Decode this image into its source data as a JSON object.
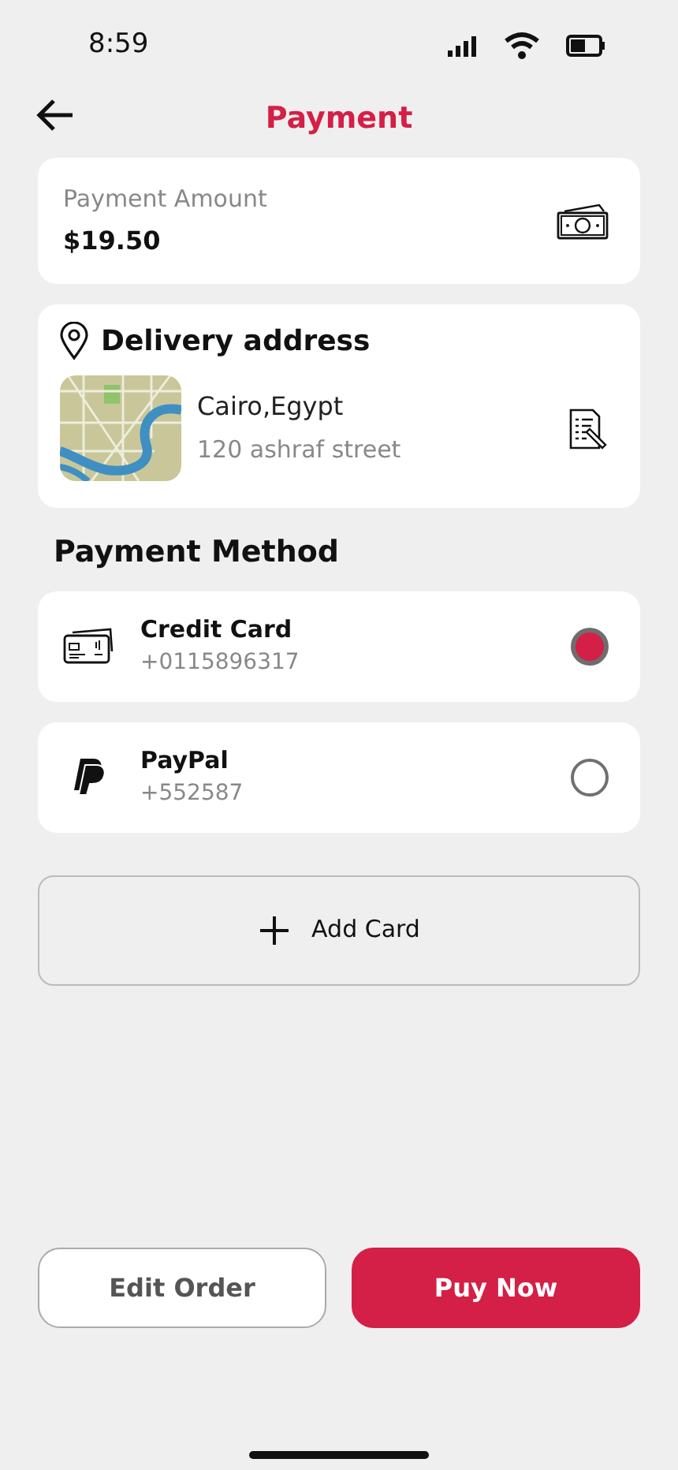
{
  "status_bar": {
    "time": "8:59"
  },
  "header": {
    "title": "Payment"
  },
  "amount": {
    "label": "Payment Amount",
    "value": "$19.50"
  },
  "delivery": {
    "title": "Delivery address",
    "city": "Cairo,Egypt",
    "street": "120 ashraf street"
  },
  "payment_method": {
    "title": "Payment Method",
    "methods": [
      {
        "kind": "card",
        "name": "Credit Card",
        "number": "+0115896317",
        "selected": true
      },
      {
        "kind": "paypal",
        "name": "PayPal",
        "number": "+552587",
        "selected": false
      }
    ]
  },
  "add_card": {
    "label": "Add Card"
  },
  "buttons": [
    {
      "kind": "outline",
      "label": "Edit Order"
    },
    {
      "kind": "primary",
      "label": "Puy Now"
    }
  ]
}
